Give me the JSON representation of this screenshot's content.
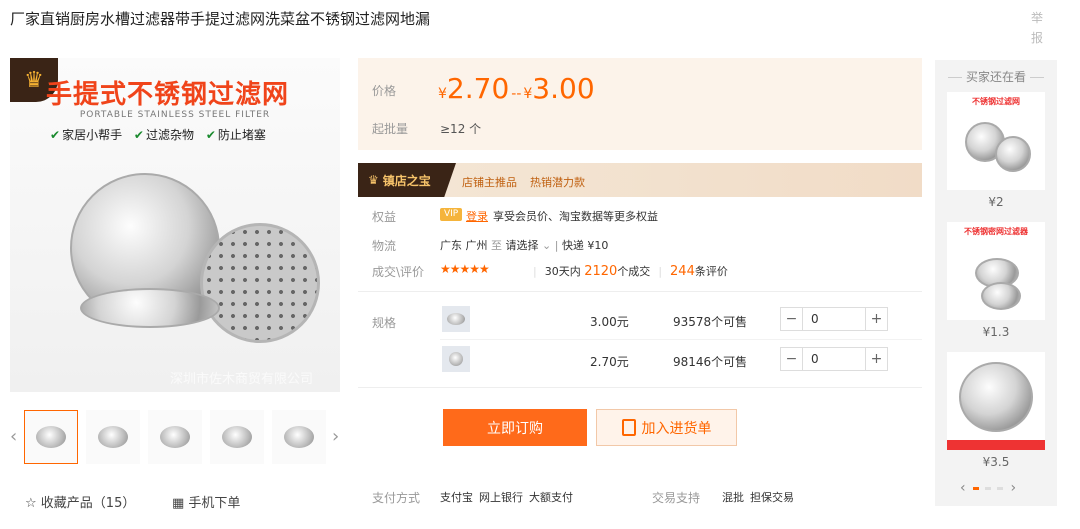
{
  "page_title": "厂家直销厨房水槽过滤器带手提过滤网洗菜盆不锈钢过滤网地漏",
  "report_label": "举报",
  "gallery": {
    "headline": "手提式不锈钢过滤网",
    "subheadline": "PORTABLE STAINLESS STEEL FILTER",
    "tags": [
      "家居小帮手",
      "过滤杂物",
      "防止堵塞"
    ],
    "watermark": "深圳市佐木商贸有限公司",
    "prev_icon": "chevron-left-icon",
    "next_icon": "chevron-right-icon",
    "thumb_count": 5
  },
  "actions": {
    "favorite": "收藏产品（15）",
    "mobile_order": "手机下单"
  },
  "price": {
    "label": "价格",
    "currency": "¥",
    "low": "2.70",
    "high": "3.00",
    "separator": "--",
    "moq_label": "起批量",
    "moq": "≥12 个"
  },
  "banner": {
    "badge": "镇店之宝",
    "promo1": "店铺主推品",
    "promo2": "热销潜力款"
  },
  "rights": {
    "label": "权益",
    "vip": "VIP",
    "login": "登录",
    "text": "享受会员价、淘宝数据等更多权益"
  },
  "logistics": {
    "label": "物流",
    "from": "广东 广州",
    "to_word": "至",
    "select": "请选择",
    "express": "快递 ¥10"
  },
  "sales": {
    "label": "成交\\评价",
    "stars": "★★★★★",
    "prefix": "30天内",
    "count": "2120",
    "count_suffix": "个成交",
    "reviews": "244",
    "reviews_suffix": "条评价"
  },
  "specs": {
    "label": "规格",
    "rows": [
      {
        "price": "3.00元",
        "stock": "93578个可售",
        "qty": "0"
      },
      {
        "price": "2.70元",
        "stock": "98146个可售",
        "qty": "0"
      }
    ],
    "minus": "−",
    "plus": "+"
  },
  "buttons": {
    "buy": "立即订购",
    "cart": "加入进货单"
  },
  "payment": {
    "label": "支付方式",
    "methods": [
      "支付宝",
      "网上银行",
      "大额支付"
    ],
    "trade_label": "交易支持",
    "trade": [
      "混批",
      "担保交易"
    ]
  },
  "sidebar": {
    "title": "买家还在看",
    "items": [
      {
        "caption": "不锈钢过滤网",
        "price": "¥2"
      },
      {
        "caption": "不锈钢密网过滤器",
        "price": "¥1.3"
      },
      {
        "caption": "",
        "price": "¥3.5"
      }
    ],
    "page_total": 3,
    "page_current": 1
  }
}
